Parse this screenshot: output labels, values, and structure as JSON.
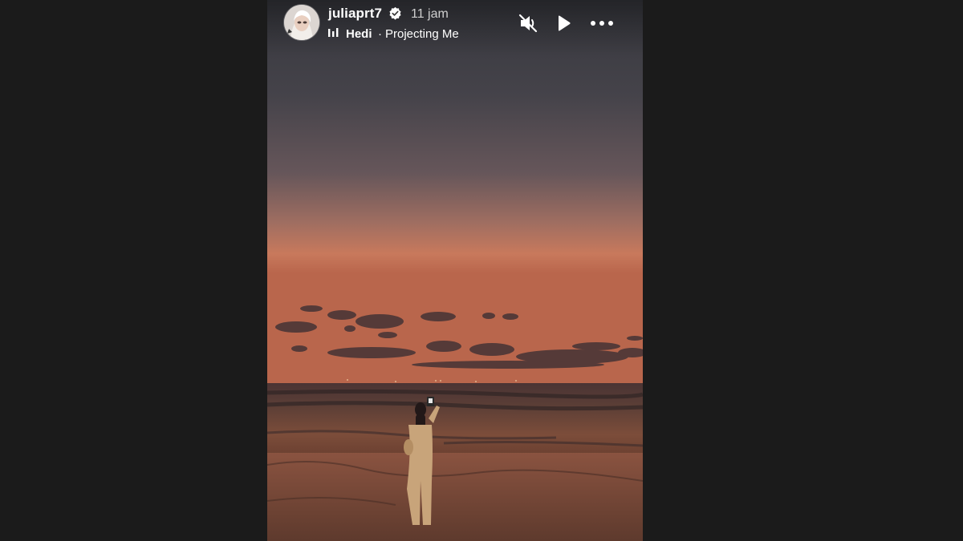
{
  "story": {
    "username": "juliaprt7",
    "verified": true,
    "timestamp": "11 jam",
    "music": {
      "artist": "Hedi",
      "separator": "·",
      "song": "Projecting Me"
    }
  },
  "controls": {
    "mute_icon": "speaker-muted-icon",
    "play_icon": "play-icon",
    "more_icon": "more-options-icon"
  },
  "colors": {
    "page_background": "#1b1b1b",
    "text_primary": "#ffffff",
    "text_secondary": "#cfcfcf"
  }
}
